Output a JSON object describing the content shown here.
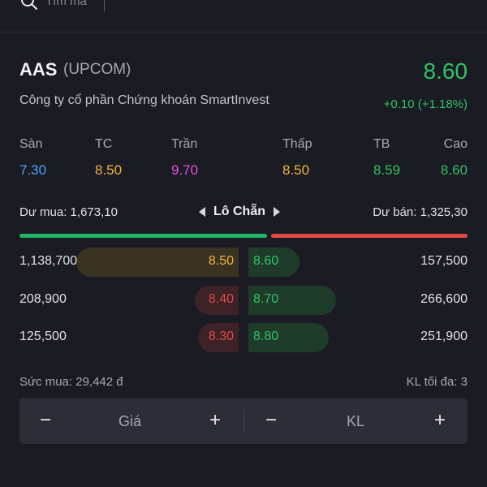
{
  "search": {
    "placeholder": "Tìm mã"
  },
  "header": {
    "ticker": "AAS",
    "exchange": "(UPCOM)",
    "company": "Công ty cổ phần Chứng khoán SmartInvest",
    "price": "8.60",
    "change": "+0.10  (+1.18%)"
  },
  "ref_prices": [
    {
      "label": "Sàn",
      "value": "7.30",
      "color": "#4aa3ff"
    },
    {
      "label": "TC",
      "value": "8.50",
      "color": "#f0b43c"
    },
    {
      "label": "Trần",
      "value": "9.70",
      "color": "#e64ce8"
    },
    {
      "label": "Thấp",
      "value": "8.50",
      "color": "#f0b43c"
    },
    {
      "label": "TB",
      "value": "8.59",
      "color": "#2fc465"
    },
    {
      "label": "Cao",
      "value": "8.60",
      "color": "#2fc465"
    }
  ],
  "depth": {
    "buy_total": "Dư mua: 1,673,10",
    "lot_label": "Lô Chẵn",
    "sell_total": "Dư bán: 1,325,30",
    "buy_ratio": 0.558
  },
  "order_book": [
    {
      "bid_vol": "1,138,700",
      "bid_price": "8.50",
      "bid_color": "#f0b43c",
      "bid_bg": "#3a3321",
      "bid_fill": 1.0,
      "ask_price": "8.60",
      "ask_vol": "157,500",
      "ask_fill": 0.21
    },
    {
      "bid_vol": "208,900",
      "bid_price": "8.40",
      "bid_color": "#e24a4a",
      "bid_bg": "#3d2226",
      "bid_fill": 0.27,
      "ask_price": "8.70",
      "ask_vol": "266,600",
      "ask_fill": 0.36
    },
    {
      "bid_vol": "125,500",
      "bid_price": "8.30",
      "bid_color": "#e24a4a",
      "bid_bg": "#3d2226",
      "bid_fill": 0.15,
      "ask_price": "8.80",
      "ask_vol": "251,900",
      "ask_fill": 0.33
    }
  ],
  "footer": {
    "buying_power": "Sức mua: 29,442 đ",
    "max_qty": "KL tối đa: 3"
  },
  "inputs": {
    "minus": "−",
    "plus": "+",
    "price_label": "Giá",
    "qty_label": "KL"
  }
}
